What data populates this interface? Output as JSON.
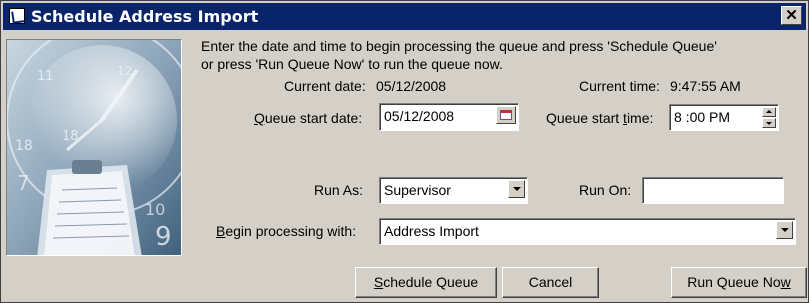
{
  "window": {
    "title": "Schedule Address Import"
  },
  "instructions": {
    "line1": "Enter the date and time to begin processing the queue and press 'Schedule Queue'",
    "line2": "or press 'Run Queue Now' to run the queue now."
  },
  "current_date": {
    "label": "Current date:",
    "value": "05/12/2008"
  },
  "current_time": {
    "label": "Current time:",
    "value": "9:47:55 AM"
  },
  "queue_start_date": {
    "label_pre": "",
    "label_mn": "Q",
    "label_post": "ueue start date:",
    "value": "05/12/2008"
  },
  "queue_start_time": {
    "label_pre": "Queue start ",
    "label_mn": "t",
    "label_post": "ime:",
    "value": "8 :00 PM"
  },
  "run_as": {
    "label": "Run As:",
    "value": "Supervisor"
  },
  "run_on": {
    "label": "Run On:",
    "value": ""
  },
  "begin_processing": {
    "label_mn": "B",
    "label_post": "egin processing with:",
    "value": "Address Import"
  },
  "buttons": {
    "schedule_mn": "S",
    "schedule_rest": "chedule Queue",
    "cancel": "Cancel",
    "run_now_pre": "Run Queue No",
    "run_now_mn": "w"
  },
  "icons": {
    "title_icon": "app-icon",
    "close": "close-icon",
    "calendar": "calendar-icon",
    "dropdown": "chevron-down-icon",
    "spinner": "spin-icon"
  },
  "colors": {
    "titlebar": "#0a246a",
    "face": "#d4d0c8"
  }
}
